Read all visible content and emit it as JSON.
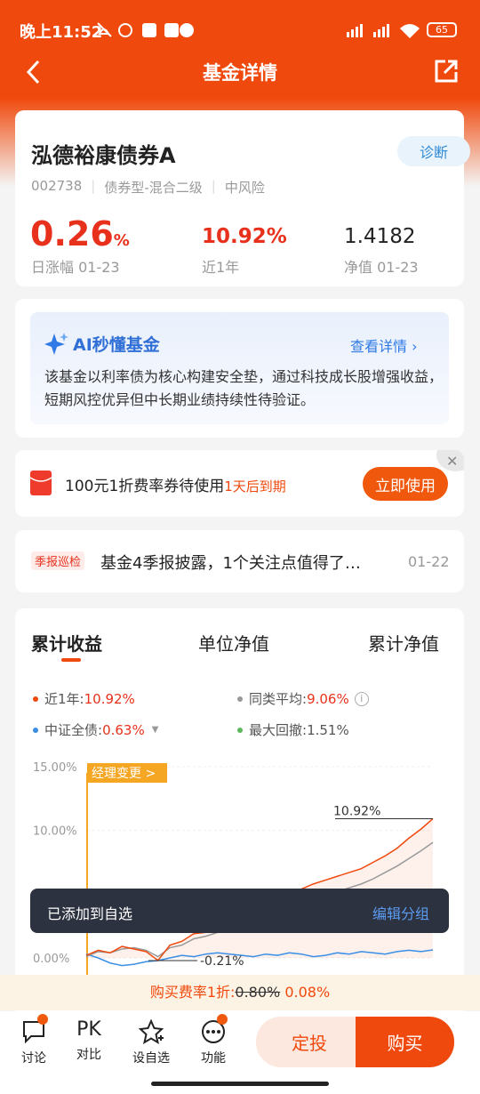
{
  "status": {
    "time": "晚上11:52",
    "battery": "65"
  },
  "nav": {
    "title": "基金详情"
  },
  "fund": {
    "name": "泓德裕康债券A",
    "diagnose": "诊断",
    "code": "002738",
    "type": "债券型-混合二级",
    "risk": "中风险",
    "daily_change": "0.26",
    "daily_unit": "%",
    "daily_label": "日涨幅 01-23",
    "year_return": "10.92%",
    "year_label": "近1年",
    "nav": "1.4182",
    "nav_label": "净值 01-23"
  },
  "ai": {
    "title": "AI秒懂基金",
    "link": "查看详情",
    "text": "该基金以利率债为核心构建安全垫，通过科技成长股增强收益，短期风控优异但中长期业绩持续性待验证。"
  },
  "coupon": {
    "text": "100元1折费率券待使用",
    "expire": "1天后到期",
    "button": "立即使用"
  },
  "report": {
    "tag": "季报巡检",
    "text": "基金4季报披露，1个关注点值得了…",
    "date": "01-22"
  },
  "chart_tabs": [
    "累计收益",
    "单位净值",
    "累计净值"
  ],
  "legend": [
    {
      "label": "近1年:",
      "value": "10.92%",
      "color": "#f0490d"
    },
    {
      "label": "同类平均:",
      "value": "9.06%",
      "color": "#999999"
    },
    {
      "label": "中证全债:",
      "value": "0.63%",
      "color": "#3a8ee6"
    },
    {
      "label": "最大回撤:",
      "value": "1.51%",
      "color": "#5cb85c"
    }
  ],
  "chart_data": {
    "type": "line",
    "y_ticks": [
      "15.00%",
      "10.00%",
      "0.00%"
    ],
    "annotations": [
      "经理变更 >",
      "10.92%",
      "-0.21%"
    ],
    "series": [
      {
        "name": "近1年",
        "color": "#f0490d",
        "values": [
          0.2,
          0.6,
          0.4,
          0.9,
          0.7,
          0.5,
          -0.2,
          1.0,
          1.3,
          1.9,
          2.0,
          2.6,
          3.0,
          3.4,
          3.7,
          4.2,
          4.6,
          5.1,
          5.4,
          5.8,
          6.1,
          6.4,
          6.7,
          7.0,
          7.5,
          8.0,
          8.6,
          9.4,
          10.1,
          10.92
        ]
      },
      {
        "name": "同类平均",
        "color": "#999999",
        "values": [
          0.1,
          0.5,
          0.4,
          0.7,
          0.8,
          0.6,
          0.1,
          0.8,
          1.0,
          1.5,
          1.7,
          2.0,
          2.5,
          2.8,
          3.0,
          3.4,
          3.8,
          4.1,
          4.4,
          4.7,
          4.9,
          5.2,
          5.5,
          5.8,
          6.2,
          6.7,
          7.2,
          7.8,
          8.4,
          9.06
        ]
      },
      {
        "name": "中证全债",
        "color": "#3a8ee6",
        "values": [
          0.3,
          0.0,
          -0.4,
          -0.6,
          -0.5,
          -0.3,
          -0.21,
          0.0,
          0.2,
          0.1,
          0.3,
          0.4,
          0.3,
          0.2,
          0.1,
          0.3,
          0.2,
          0.4,
          0.3,
          0.1,
          0.2,
          0.4,
          0.3,
          0.5,
          0.4,
          0.3,
          0.5,
          0.6,
          0.5,
          0.63
        ]
      }
    ]
  },
  "toast": {
    "text": "已添加到自选",
    "action": "编辑分组"
  },
  "buy_rate": {
    "label": "购买费率1折:",
    "old": "0.80%",
    "new": "0.08%"
  },
  "tabbar": {
    "items": [
      "讨论",
      "对比",
      "设自选",
      "功能"
    ],
    "pk": "PK",
    "fixed": "定投",
    "buy": "购买"
  }
}
